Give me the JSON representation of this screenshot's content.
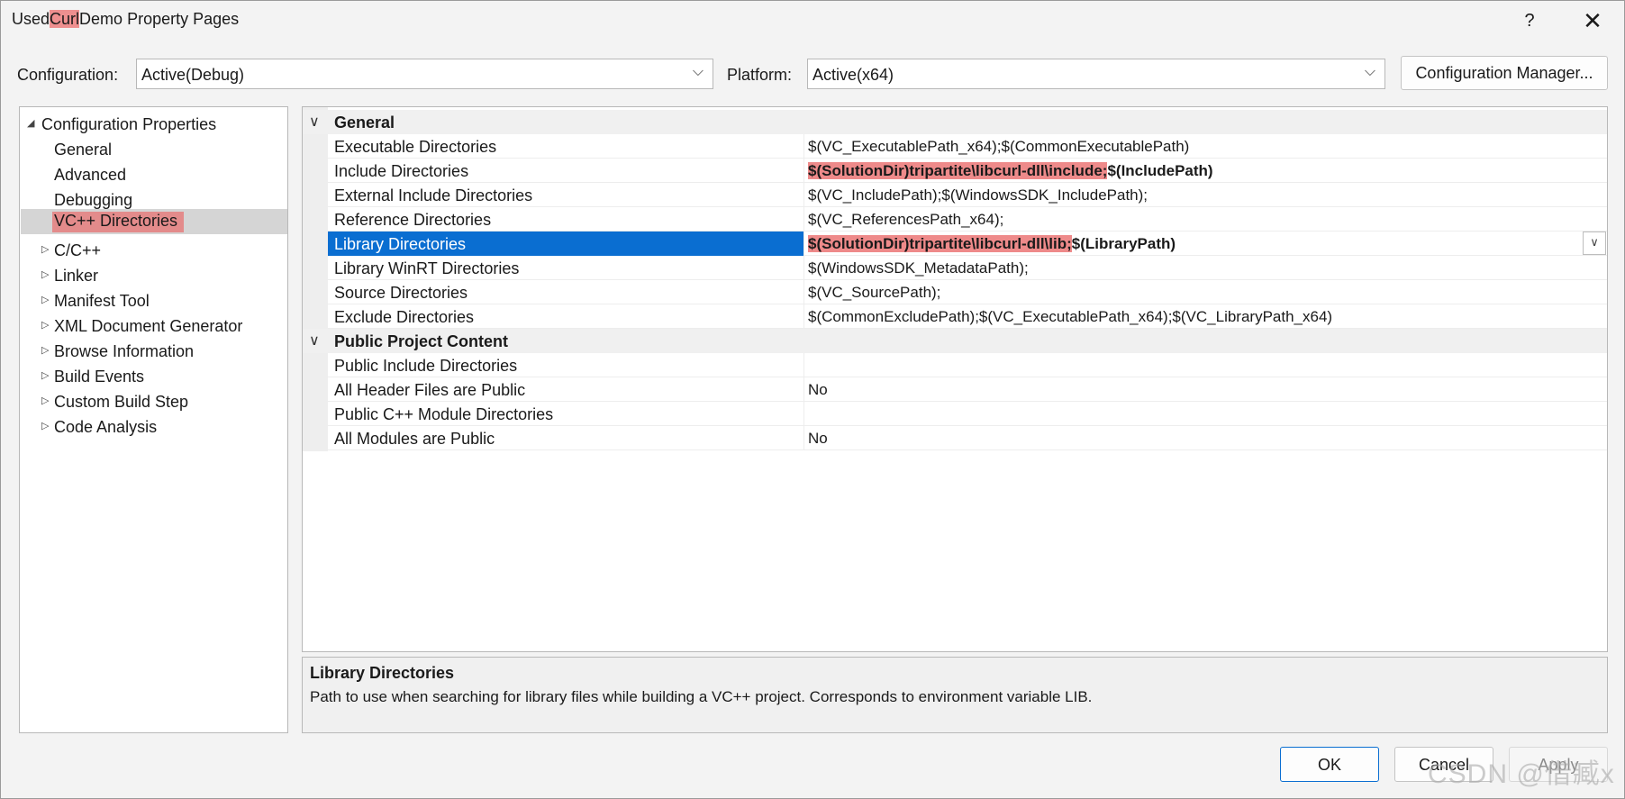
{
  "window": {
    "title_prefix": "Used",
    "title_highlight": "Curl",
    "title_suffix": "Demo Property Pages",
    "help_label": "?",
    "close_label": "✕"
  },
  "config": {
    "configuration_label": "Configuration:",
    "configuration_value": "Active(Debug)",
    "platform_label": "Platform:",
    "platform_value": "Active(x64)",
    "manager_button": "Configuration Manager..."
  },
  "tree": {
    "root": "Configuration Properties",
    "items": [
      {
        "label": "General"
      },
      {
        "label": "Advanced"
      },
      {
        "label": "Debugging"
      },
      {
        "label": "VC++ Directories",
        "selected": true
      },
      {
        "label": "C/C++"
      },
      {
        "label": "Linker"
      },
      {
        "label": "Manifest Tool"
      },
      {
        "label": "XML Document Generator"
      },
      {
        "label": "Browse Information"
      },
      {
        "label": "Build Events"
      },
      {
        "label": "Custom Build Step"
      },
      {
        "label": "Code Analysis"
      }
    ]
  },
  "grid": {
    "categories": [
      {
        "name": "General",
        "rows": [
          {
            "name": "Executable Directories",
            "value": "$(VC_ExecutablePath_x64);$(CommonExecutablePath)"
          },
          {
            "name": "Include Directories",
            "value_highlight": "$(SolutionDir)tripartite\\libcurl-dll\\include;",
            "value_rest": "$(IncludePath)"
          },
          {
            "name": "External Include Directories",
            "value": "$(VC_IncludePath);$(WindowsSDK_IncludePath);"
          },
          {
            "name": "Reference Directories",
            "value": "$(VC_ReferencesPath_x64);"
          },
          {
            "name": "Library Directories",
            "value_highlight": "$(SolutionDir)tripartite\\libcurl-dll\\lib;",
            "value_rest": "$(LibraryPath)",
            "selected": true
          },
          {
            "name": "Library WinRT Directories",
            "value": "$(WindowsSDK_MetadataPath);"
          },
          {
            "name": "Source Directories",
            "value": "$(VC_SourcePath);"
          },
          {
            "name": "Exclude Directories",
            "value": "$(CommonExcludePath);$(VC_ExecutablePath_x64);$(VC_LibraryPath_x64)"
          }
        ]
      },
      {
        "name": "Public Project Content",
        "rows": [
          {
            "name": "Public Include Directories",
            "value": ""
          },
          {
            "name": "All Header Files are Public",
            "value": "No"
          },
          {
            "name": "Public C++ Module Directories",
            "value": ""
          },
          {
            "name": "All Modules are Public",
            "value": "No"
          }
        ]
      }
    ]
  },
  "description": {
    "title": "Library Directories",
    "text": "Path to use when searching for library files while building a VC++ project.  Corresponds to environment variable LIB."
  },
  "buttons": {
    "ok": "OK",
    "cancel": "Cancel",
    "apply": "Apply"
  },
  "watermark": "CSDN @借臧x",
  "colors": {
    "selection_blue": "#0a6ed1",
    "highlight_red": "#ee8a8a"
  }
}
